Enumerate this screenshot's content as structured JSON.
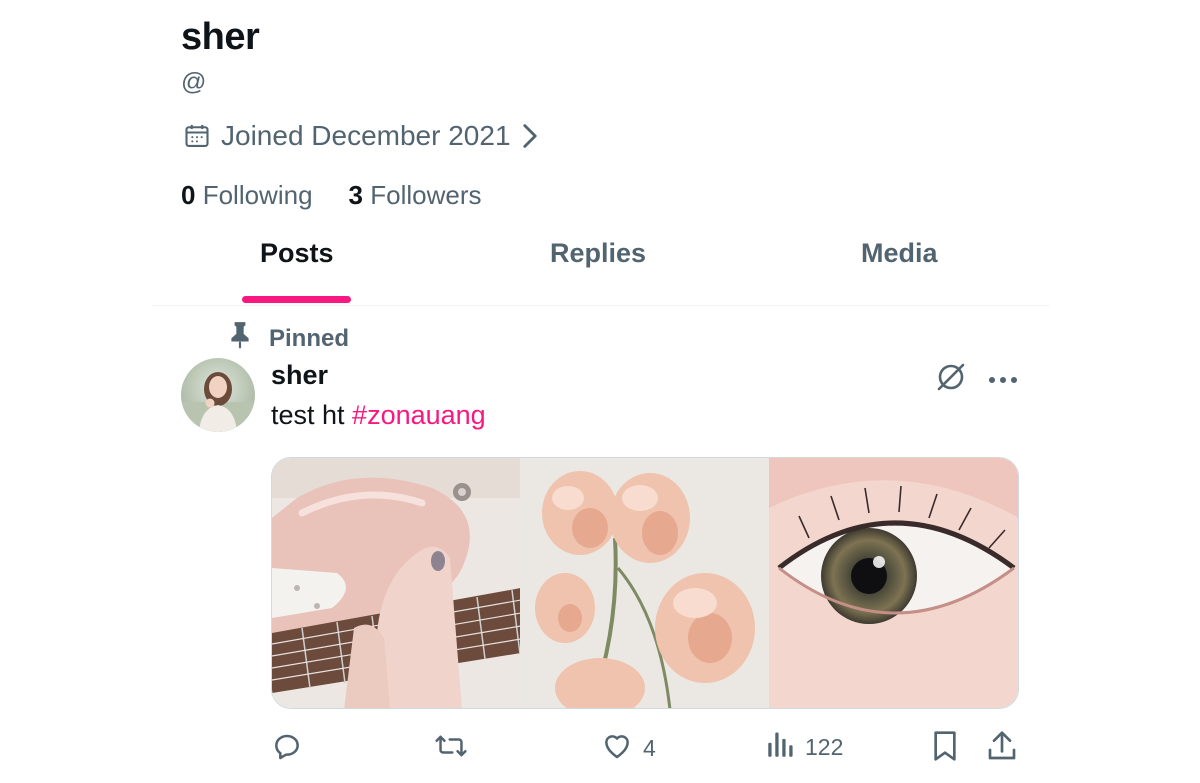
{
  "profile": {
    "display_name": "sher",
    "handle": "@",
    "joined": "Joined December 2021",
    "following_count": "0",
    "following_label": "Following",
    "followers_count": "3",
    "followers_label": "Followers"
  },
  "tabs": [
    {
      "label": "Posts",
      "active": true
    },
    {
      "label": "Replies",
      "active": false
    },
    {
      "label": "Media",
      "active": false
    }
  ],
  "post": {
    "pinned_label": "Pinned",
    "author": "sher",
    "text": "test ht ",
    "hashtag": "#zonauang",
    "images": [
      "pink-guitar",
      "peach-flowers",
      "eye-closeup"
    ],
    "actions": {
      "replies": "",
      "reposts": "",
      "likes": "4",
      "views": "122"
    }
  },
  "colors": {
    "accent": "#f91880",
    "text_primary": "#0f1419",
    "text_secondary": "#536471",
    "border": "#eff3f4"
  }
}
